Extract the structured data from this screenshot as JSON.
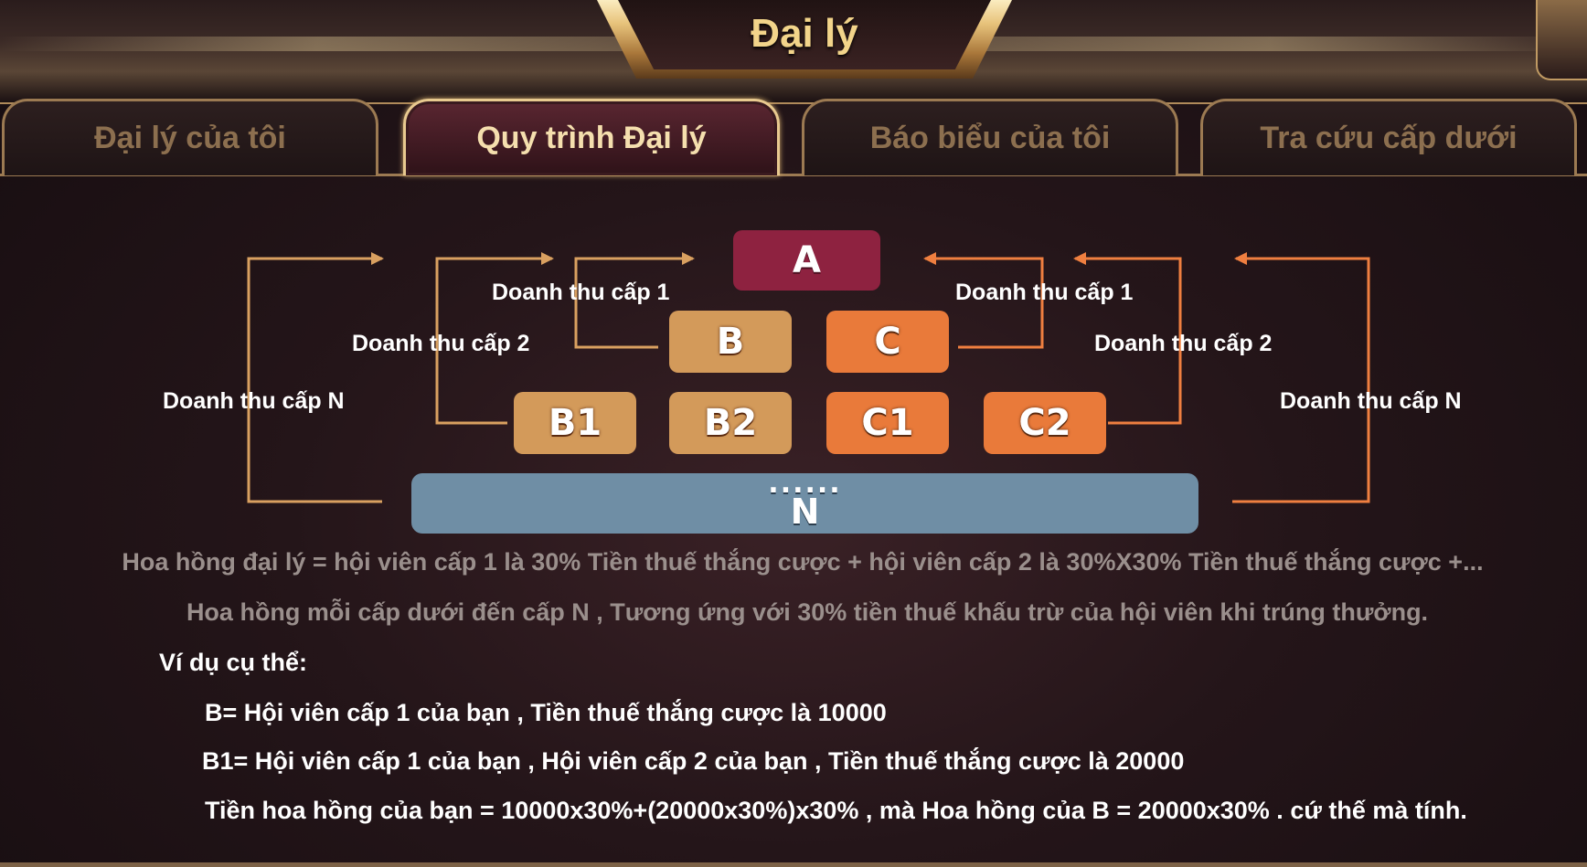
{
  "header": {
    "title": "Đại lý"
  },
  "tabs": [
    {
      "label": "Đại lý của tôi",
      "active": false
    },
    {
      "label": "Quy trình Đại lý",
      "active": true
    },
    {
      "label": "Báo biểu của tôi",
      "active": false
    },
    {
      "label": "Tra cứu cấp dưới",
      "active": false
    }
  ],
  "diagram": {
    "nodes": {
      "a": "A",
      "b": "B",
      "c": "C",
      "b1": "B1",
      "b2": "B2",
      "c1": "C1",
      "c2": "C2",
      "n_dots": "......",
      "n": "N"
    },
    "labels": {
      "left_level1": "Doanh thu cấp 1",
      "right_level1": "Doanh thu cấp 1",
      "left_level2": "Doanh thu cấp 2",
      "right_level2": "Doanh thu cấp 2",
      "left_levelN": "Doanh thu cấp N",
      "right_levelN": "Doanh thu cấp N"
    },
    "colors": {
      "a": "#8e2240",
      "b_side": "#d39a5a",
      "c_side": "#e97a3a",
      "n": "#6f8ea5",
      "arrow_left": "#d9a060",
      "arrow_right": "#ef7f40"
    }
  },
  "explanation": {
    "line1": "Hoa hồng đại lý = hội viên cấp 1 là 30% Tiền thuế thắng cược + hội viên cấp 2 là  30%X30% Tiền thuế thắng cược +...",
    "line2": "Hoa hồng mỗi cấp dưới đến cấp N , Tương ứng với 30% tiền thuế khấu trừ của hội viên khi trúng thưởng."
  },
  "example": {
    "heading": "Ví dụ cụ thể:",
    "line1": "B= Hội viên cấp 1 của bạn , Tiền thuế thắng cược là 10000",
    "line2": "B1= Hội viên cấp 1 của bạn , Hội viên cấp 2 của bạn , Tiền thuế thắng cược là 20000",
    "line3": "Tiền hoa hồng của bạn = 10000x30%+(20000x30%)x30% ,  mà Hoa hồng của B = 20000x30% . cứ thế mà tính."
  }
}
